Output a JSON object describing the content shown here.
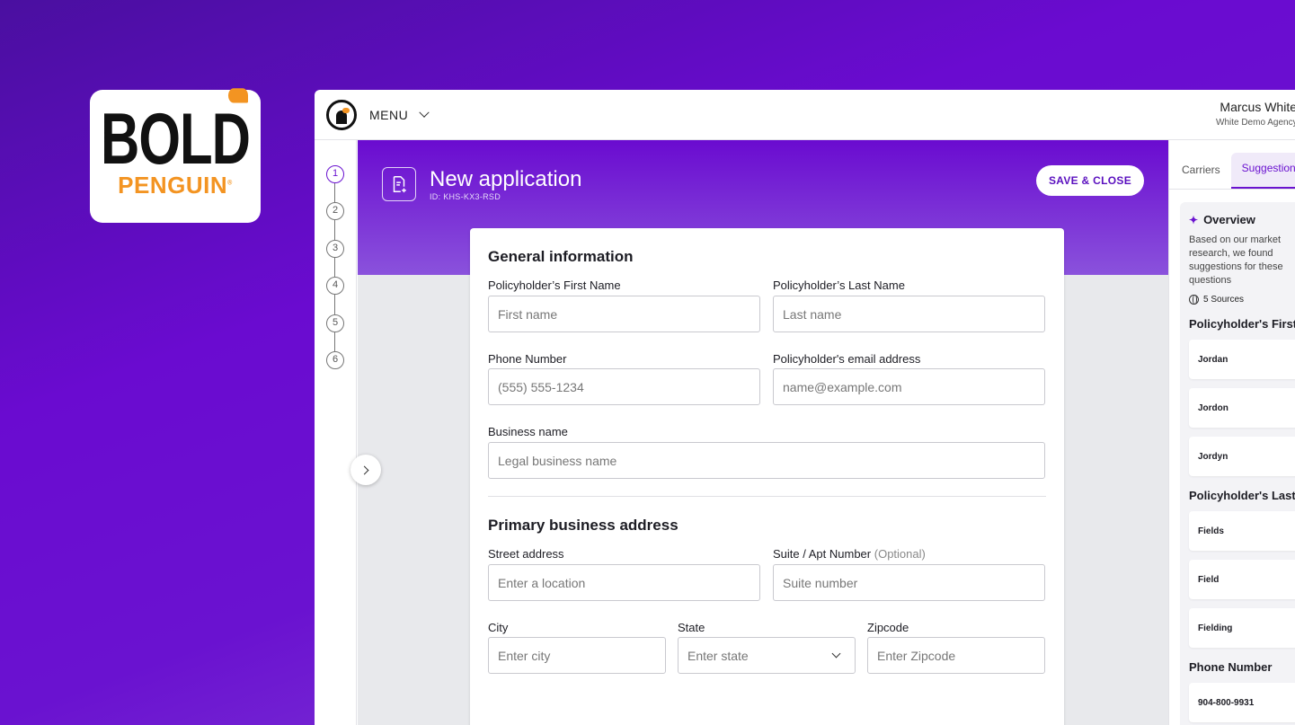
{
  "logo": {
    "word1": "BOLD",
    "word2": "PENGUIN",
    "reg": "®"
  },
  "topbar": {
    "menu_label": "MENU",
    "user_name": "Marcus White",
    "user_agency": "White Demo Agency"
  },
  "stepper": {
    "steps": [
      "1",
      "2",
      "3",
      "4",
      "5",
      "6"
    ],
    "active": 1
  },
  "header": {
    "title": "New application",
    "id_label": "ID: KHS-KX3-RSD",
    "save_label": "SAVE & CLOSE"
  },
  "form": {
    "general_title": "General information",
    "first_name_label": "Policyholder’s First Name",
    "first_name_placeholder": "First name",
    "last_name_label": "Policyholder’s Last Name",
    "last_name_placeholder": "Last name",
    "phone_label": "Phone Number",
    "phone_placeholder": "(555) 555-1234",
    "email_label": "Policyholder's email address",
    "email_placeholder": "name@example.com",
    "business_label": "Business name",
    "business_placeholder": "Legal business name",
    "address_title": "Primary business address",
    "street_label": "Street address",
    "street_placeholder": "Enter a location",
    "suite_label": "Suite / Apt Number",
    "suite_optional": "(Optional)",
    "suite_placeholder": "Suite number",
    "city_label": "City",
    "city_placeholder": "Enter city",
    "state_label": "State",
    "state_placeholder": "Enter state",
    "zip_label": "Zipcode",
    "zip_placeholder": "Enter Zipcode"
  },
  "right_panel": {
    "tabs": [
      "Carriers",
      "Suggestions"
    ],
    "overview_title": "Overview",
    "overview_desc": "Based on our market research, we found suggestions for these questions",
    "sources": "5 Sources",
    "groups": [
      {
        "title": "Policyholder's First Name",
        "items": [
          "Jordan",
          "Jordon",
          "Jordyn"
        ]
      },
      {
        "title": "Policyholder's Last Name",
        "items": [
          "Fields",
          "Field",
          "Fielding"
        ]
      },
      {
        "title": "Phone Number",
        "items": [
          "904-800-9931"
        ]
      }
    ]
  }
}
